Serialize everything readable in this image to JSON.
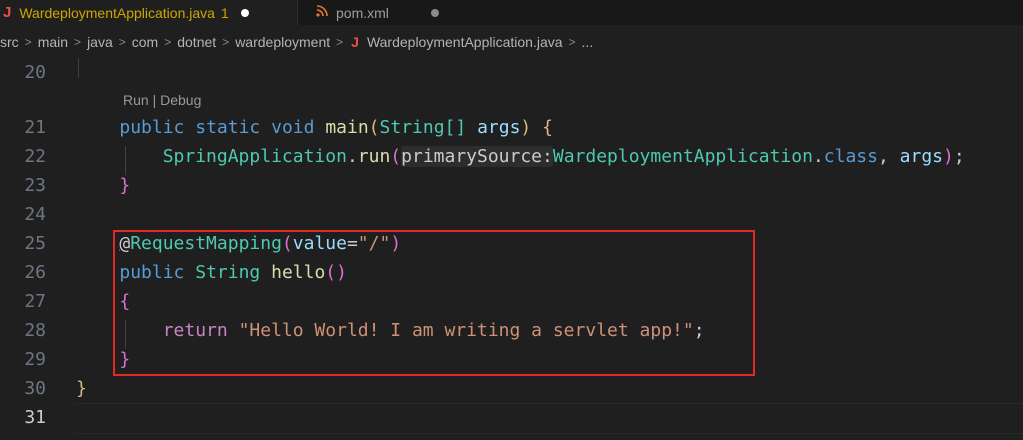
{
  "tabs": [
    {
      "icon": "J",
      "label": "WardeploymentApplication.java",
      "problems": "1"
    },
    {
      "icon": "rss-icon",
      "label": "pom.xml"
    }
  ],
  "breadcrumb": {
    "items": [
      "src",
      "main",
      "java",
      "com",
      "dotnet",
      "wardeployment"
    ],
    "file": "WardeploymentApplication.java",
    "more": "..."
  },
  "codelens": "Run | Debug",
  "line_numbers": [
    "20",
    "21",
    "22",
    "23",
    "24",
    "25",
    "26",
    "27",
    "28",
    "29",
    "30",
    "31"
  ],
  "code": {
    "l21": {
      "kw1": "public",
      "kw2": "static",
      "kw3": "void",
      "fn": "main",
      "po": "(",
      "ty": "String[]",
      "pa": "args",
      "pc": ")",
      "bo": "{"
    },
    "l22": {
      "ty": "SpringApplication",
      "dot": ".",
      "fn": "run",
      "po": "(",
      "hint": "primarySource:",
      "cls": "WardeploymentApplication",
      "dot2": ".",
      "kw": "class",
      "comma": ", ",
      "pa": "args",
      "pc": ")",
      "semi": ";"
    },
    "l23": {
      "bc": "}"
    },
    "l25": {
      "at": "@",
      "ann": "RequestMapping",
      "po": "(",
      "pa": "value",
      "eq": "=",
      "st": "\"/\"",
      "pc": ")"
    },
    "l26": {
      "kw": "public",
      "ty": "String",
      "fn": "hello",
      "p": "()"
    },
    "l27": {
      "bo": "{"
    },
    "l28": {
      "kw": "return",
      "st": "\"Hello World! I am writing a servlet app!\"",
      "semi": ";"
    },
    "l29": {
      "bc": "}"
    },
    "l30": {
      "bc": "}"
    }
  }
}
